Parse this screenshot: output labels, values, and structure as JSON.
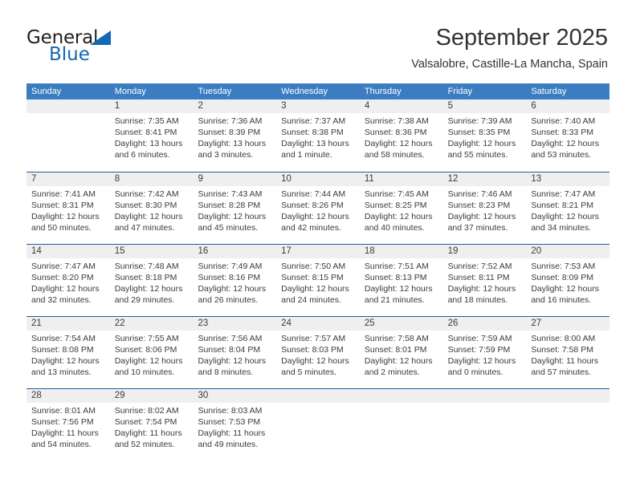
{
  "brand": {
    "name_part1": "General",
    "name_part2": "Blue",
    "triangle_icon": "triangle-icon",
    "colors": {
      "dark": "#231f20",
      "blue": "#1368b3"
    }
  },
  "header": {
    "title": "September 2025",
    "subtitle": "Valsalobre, Castille-La Mancha, Spain"
  },
  "colors": {
    "header_row_bg": "#3b7dc0",
    "row_separator": "#1f5fa6",
    "daynum_band_bg": "#efefef",
    "text": "#3b3b3b"
  },
  "weekdays": [
    "Sunday",
    "Monday",
    "Tuesday",
    "Wednesday",
    "Thursday",
    "Friday",
    "Saturday"
  ],
  "weeks": [
    [
      {
        "day": "",
        "sunrise": "",
        "sunset": "",
        "daylight": ""
      },
      {
        "day": "1",
        "sunrise": "Sunrise: 7:35 AM",
        "sunset": "Sunset: 8:41 PM",
        "daylight": "Daylight: 13 hours and 6 minutes."
      },
      {
        "day": "2",
        "sunrise": "Sunrise: 7:36 AM",
        "sunset": "Sunset: 8:39 PM",
        "daylight": "Daylight: 13 hours and 3 minutes."
      },
      {
        "day": "3",
        "sunrise": "Sunrise: 7:37 AM",
        "sunset": "Sunset: 8:38 PM",
        "daylight": "Daylight: 13 hours and 1 minute."
      },
      {
        "day": "4",
        "sunrise": "Sunrise: 7:38 AM",
        "sunset": "Sunset: 8:36 PM",
        "daylight": "Daylight: 12 hours and 58 minutes."
      },
      {
        "day": "5",
        "sunrise": "Sunrise: 7:39 AM",
        "sunset": "Sunset: 8:35 PM",
        "daylight": "Daylight: 12 hours and 55 minutes."
      },
      {
        "day": "6",
        "sunrise": "Sunrise: 7:40 AM",
        "sunset": "Sunset: 8:33 PM",
        "daylight": "Daylight: 12 hours and 53 minutes."
      }
    ],
    [
      {
        "day": "7",
        "sunrise": "Sunrise: 7:41 AM",
        "sunset": "Sunset: 8:31 PM",
        "daylight": "Daylight: 12 hours and 50 minutes."
      },
      {
        "day": "8",
        "sunrise": "Sunrise: 7:42 AM",
        "sunset": "Sunset: 8:30 PM",
        "daylight": "Daylight: 12 hours and 47 minutes."
      },
      {
        "day": "9",
        "sunrise": "Sunrise: 7:43 AM",
        "sunset": "Sunset: 8:28 PM",
        "daylight": "Daylight: 12 hours and 45 minutes."
      },
      {
        "day": "10",
        "sunrise": "Sunrise: 7:44 AM",
        "sunset": "Sunset: 8:26 PM",
        "daylight": "Daylight: 12 hours and 42 minutes."
      },
      {
        "day": "11",
        "sunrise": "Sunrise: 7:45 AM",
        "sunset": "Sunset: 8:25 PM",
        "daylight": "Daylight: 12 hours and 40 minutes."
      },
      {
        "day": "12",
        "sunrise": "Sunrise: 7:46 AM",
        "sunset": "Sunset: 8:23 PM",
        "daylight": "Daylight: 12 hours and 37 minutes."
      },
      {
        "day": "13",
        "sunrise": "Sunrise: 7:47 AM",
        "sunset": "Sunset: 8:21 PM",
        "daylight": "Daylight: 12 hours and 34 minutes."
      }
    ],
    [
      {
        "day": "14",
        "sunrise": "Sunrise: 7:47 AM",
        "sunset": "Sunset: 8:20 PM",
        "daylight": "Daylight: 12 hours and 32 minutes."
      },
      {
        "day": "15",
        "sunrise": "Sunrise: 7:48 AM",
        "sunset": "Sunset: 8:18 PM",
        "daylight": "Daylight: 12 hours and 29 minutes."
      },
      {
        "day": "16",
        "sunrise": "Sunrise: 7:49 AM",
        "sunset": "Sunset: 8:16 PM",
        "daylight": "Daylight: 12 hours and 26 minutes."
      },
      {
        "day": "17",
        "sunrise": "Sunrise: 7:50 AM",
        "sunset": "Sunset: 8:15 PM",
        "daylight": "Daylight: 12 hours and 24 minutes."
      },
      {
        "day": "18",
        "sunrise": "Sunrise: 7:51 AM",
        "sunset": "Sunset: 8:13 PM",
        "daylight": "Daylight: 12 hours and 21 minutes."
      },
      {
        "day": "19",
        "sunrise": "Sunrise: 7:52 AM",
        "sunset": "Sunset: 8:11 PM",
        "daylight": "Daylight: 12 hours and 18 minutes."
      },
      {
        "day": "20",
        "sunrise": "Sunrise: 7:53 AM",
        "sunset": "Sunset: 8:09 PM",
        "daylight": "Daylight: 12 hours and 16 minutes."
      }
    ],
    [
      {
        "day": "21",
        "sunrise": "Sunrise: 7:54 AM",
        "sunset": "Sunset: 8:08 PM",
        "daylight": "Daylight: 12 hours and 13 minutes."
      },
      {
        "day": "22",
        "sunrise": "Sunrise: 7:55 AM",
        "sunset": "Sunset: 8:06 PM",
        "daylight": "Daylight: 12 hours and 10 minutes."
      },
      {
        "day": "23",
        "sunrise": "Sunrise: 7:56 AM",
        "sunset": "Sunset: 8:04 PM",
        "daylight": "Daylight: 12 hours and 8 minutes."
      },
      {
        "day": "24",
        "sunrise": "Sunrise: 7:57 AM",
        "sunset": "Sunset: 8:03 PM",
        "daylight": "Daylight: 12 hours and 5 minutes."
      },
      {
        "day": "25",
        "sunrise": "Sunrise: 7:58 AM",
        "sunset": "Sunset: 8:01 PM",
        "daylight": "Daylight: 12 hours and 2 minutes."
      },
      {
        "day": "26",
        "sunrise": "Sunrise: 7:59 AM",
        "sunset": "Sunset: 7:59 PM",
        "daylight": "Daylight: 12 hours and 0 minutes."
      },
      {
        "day": "27",
        "sunrise": "Sunrise: 8:00 AM",
        "sunset": "Sunset: 7:58 PM",
        "daylight": "Daylight: 11 hours and 57 minutes."
      }
    ],
    [
      {
        "day": "28",
        "sunrise": "Sunrise: 8:01 AM",
        "sunset": "Sunset: 7:56 PM",
        "daylight": "Daylight: 11 hours and 54 minutes."
      },
      {
        "day": "29",
        "sunrise": "Sunrise: 8:02 AM",
        "sunset": "Sunset: 7:54 PM",
        "daylight": "Daylight: 11 hours and 52 minutes."
      },
      {
        "day": "30",
        "sunrise": "Sunrise: 8:03 AM",
        "sunset": "Sunset: 7:53 PM",
        "daylight": "Daylight: 11 hours and 49 minutes."
      },
      {
        "day": "",
        "sunrise": "",
        "sunset": "",
        "daylight": ""
      },
      {
        "day": "",
        "sunrise": "",
        "sunset": "",
        "daylight": ""
      },
      {
        "day": "",
        "sunrise": "",
        "sunset": "",
        "daylight": ""
      },
      {
        "day": "",
        "sunrise": "",
        "sunset": "",
        "daylight": ""
      }
    ]
  ]
}
